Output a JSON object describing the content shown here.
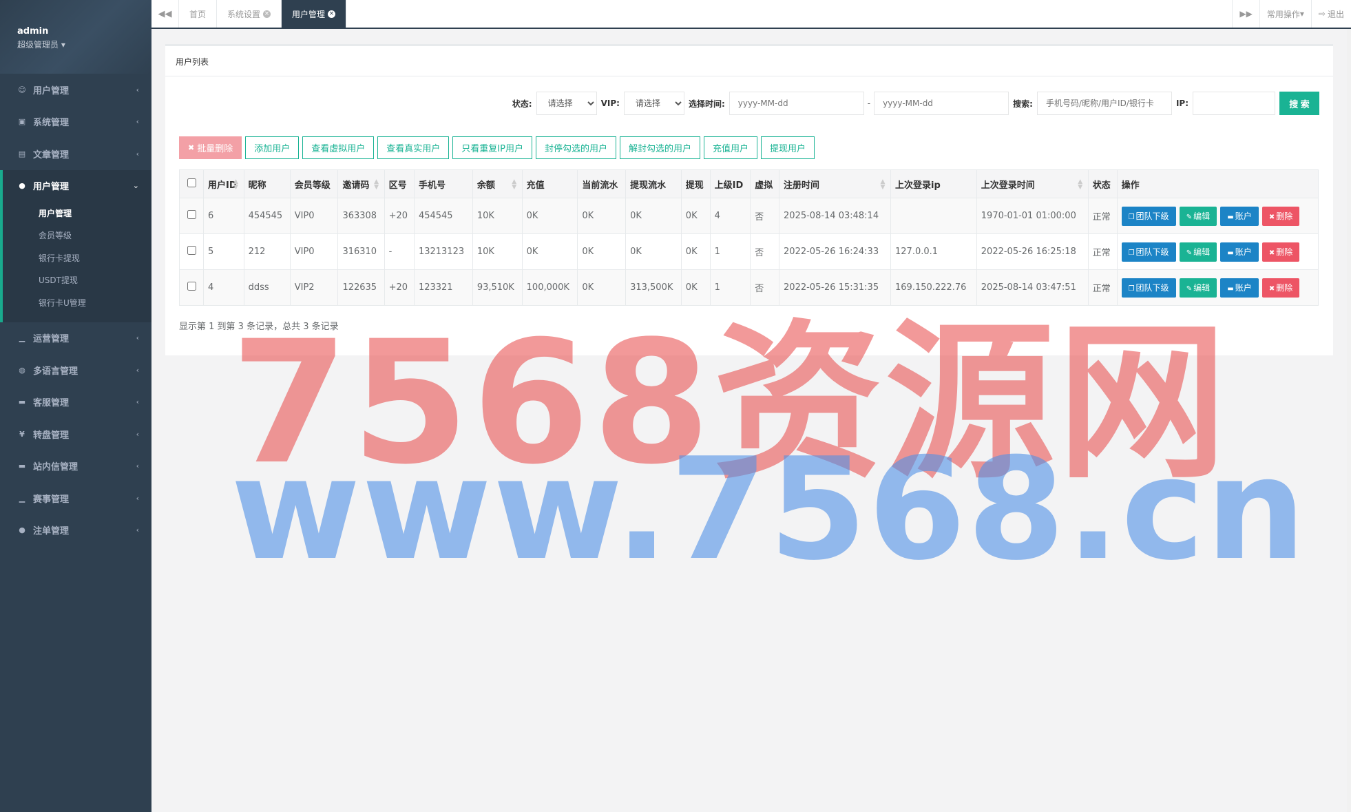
{
  "profile": {
    "name": "admin",
    "role": "超级管理员 ▾"
  },
  "sidebar": {
    "items_top": [
      {
        "label": "用户管理",
        "icon": "users-icon"
      },
      {
        "label": "系统管理",
        "icon": "desktop-icon"
      },
      {
        "label": "文章管理",
        "icon": "book-icon"
      }
    ],
    "active_group": {
      "label": "用户管理",
      "subs": [
        "用户管理",
        "会员等级",
        "银行卡提现",
        "USDT提现",
        "银行卡U管理"
      ]
    },
    "items_bottom": [
      {
        "label": "运营管理",
        "icon": "bar-chart-icon"
      },
      {
        "label": "多语言管理",
        "icon": "globe-icon"
      },
      {
        "label": "客服管理",
        "icon": "comment-icon"
      },
      {
        "label": "转盘管理",
        "icon": "yen-icon"
      },
      {
        "label": "站内信管理",
        "icon": "comment-icon"
      },
      {
        "label": "赛事管理",
        "icon": "bar-chart-icon"
      },
      {
        "label": "注单管理",
        "icon": "user-icon"
      }
    ]
  },
  "topbar": {
    "tabs": [
      "首页",
      "系统设置",
      "用户管理"
    ],
    "common_ops": "常用操作",
    "logout": "退出"
  },
  "panel": {
    "title": "用户列表",
    "filters": {
      "status_label": "状态:",
      "status_value": "请选择",
      "vip_label": "VIP:",
      "vip_value": "请选择",
      "time_label": "选择时间:",
      "date_placeholder": "yyyy-MM-dd",
      "date_sep": "-",
      "search_label": "搜索:",
      "search_placeholder": "手机号码/昵称/用户ID/银行卡",
      "ip_label": "IP:",
      "search_button": "搜 索"
    },
    "actions": [
      "批量删除",
      "添加用户",
      "查看虚拟用户",
      "查看真实用户",
      "只看重复IP用户",
      "封停勾选的用户",
      "解封勾选的用户",
      "充值用户",
      "提现用户"
    ],
    "columns": [
      "用户ID",
      "昵称",
      "会员等级",
      "邀请码",
      "区号",
      "手机号",
      "余额",
      "充值",
      "当前流水",
      "提现流水",
      "提现",
      "上级ID",
      "虚拟",
      "注册时间",
      "上次登录ip",
      "上次登录时间",
      "状态",
      "操作"
    ],
    "rows": [
      [
        "6",
        "454545",
        "VIP0",
        "363308",
        "+20",
        "454545",
        "10K",
        "0K",
        "0K",
        "0K",
        "0K",
        "4",
        "否",
        "2025-08-14 03:48:14",
        "",
        "1970-01-01 01:00:00",
        "正常"
      ],
      [
        "5",
        "212",
        "VIP0",
        "316310",
        "-",
        "13213123",
        "10K",
        "0K",
        "0K",
        "0K",
        "0K",
        "1",
        "否",
        "2022-05-26 16:24:33",
        "127.0.0.1",
        "2022-05-26 16:25:18",
        "正常"
      ],
      [
        "4",
        "ddss",
        "VIP2",
        "122635",
        "+20",
        "123321",
        "93,510K",
        "100,000K",
        "0K",
        "313,500K",
        "0K",
        "1",
        "否",
        "2022-05-26 15:31:35",
        "169.150.222.76",
        "2025-08-14 03:47:51",
        "正常"
      ]
    ],
    "row_ops": [
      "团队下级",
      "编辑",
      "账户",
      "删除"
    ],
    "footer": "显示第 1 到第 3 条记录，总共 3 条记录"
  },
  "watermark": {
    "line1": "7568资源网",
    "line2": "www.7568.cn"
  }
}
